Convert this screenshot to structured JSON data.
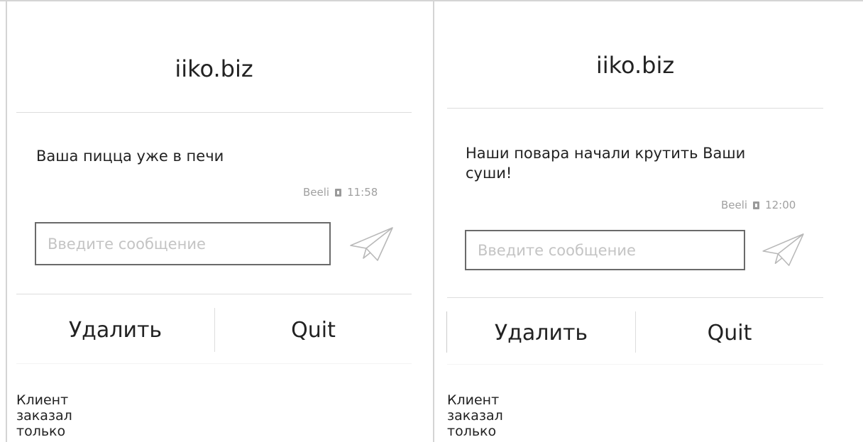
{
  "panels": [
    {
      "title": "iiko.biz",
      "message": "Ваша пицца уже в печи",
      "sender": "Beeli",
      "time": "11:58",
      "input_placeholder": "Введите сообщение",
      "delete_label": "Удалить",
      "quit_label": "Quit",
      "caption": "Клиент заказал только пиццу"
    },
    {
      "title": "iiko.biz",
      "message": "Наши повара начали крутить Ваши суши!",
      "sender": "Beeli",
      "time": "12:00",
      "input_placeholder": "Введите сообщение",
      "delete_label": "Удалить",
      "quit_label": "Quit",
      "caption": "Клиент заказал только суши"
    }
  ],
  "icons": {
    "send": "paper-plane-icon",
    "meta": "device-icon"
  },
  "colors": {
    "border": "#d4d4d4",
    "divider": "#dddddd",
    "input_border": "#6a6a6a",
    "placeholder": "#c4c4c4",
    "meta_text": "#a0a0a0"
  }
}
